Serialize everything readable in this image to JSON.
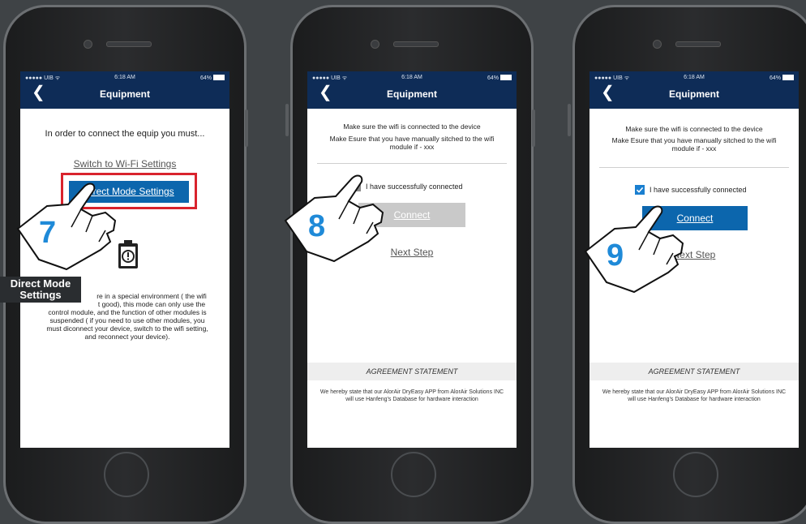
{
  "status_bar": {
    "carrier": "●●●●● UIB ᯤ",
    "time": "6:18 AM",
    "battery": "64%"
  },
  "nav": {
    "title": "Equipment",
    "back_icon": "chevron-left-icon"
  },
  "phone1": {
    "heading": "In order to connect the equip you must...",
    "wifi_link": "Switch to Wi-Fi Settings",
    "direct_button": "Direct Mode Settings",
    "warning_icon": "clipboard-exclamation-icon",
    "info_lines": [
      "re in a special environment ( the wifi",
      "t good), this mode can only use the",
      "control module, and the function of other modules is",
      "suspended ( if you need to use other modules, you",
      "must diconnect your device, switch to the wifi setting,",
      "and reconnect your device)."
    ],
    "step": "7",
    "tip_label": "Direct Mode Settings",
    "highlight_color": "#d9232d"
  },
  "phone2": {
    "line1": "Make sure the wifi is connected to the device",
    "line2": "Make Esure that you have manually sitched to the wifi module if - xxx",
    "checkbox_label": "I have successfully connected",
    "checked": false,
    "connect_button": "Connect",
    "next_link": "Next Step",
    "agreement_title": "AGREEMENT STATEMENT",
    "agreement_text": "We hereby state that our AlorAir DryEasy APP from AlorAir Solutions INC will use Hanfeng's Database for hardware interaction",
    "step": "8"
  },
  "phone3": {
    "line1": "Make sure the wifi is connected to the device",
    "line2": "Make Esure that you have manually sitched to the wifi module if - xxx",
    "checkbox_label": "I have successfully connected",
    "checked": true,
    "connect_button": "Connect",
    "next_link": "Next Step",
    "agreement_title": "AGREEMENT STATEMENT",
    "agreement_text": "We hereby state that our AlorAir DryEasy APP from AlorAir Solutions INC will use Hanfeng's Database for hardware interaction",
    "step": "9"
  },
  "colors": {
    "navbar": "#0e2c57",
    "button": "#0c66ad",
    "step_number": "#1f8ad8"
  }
}
